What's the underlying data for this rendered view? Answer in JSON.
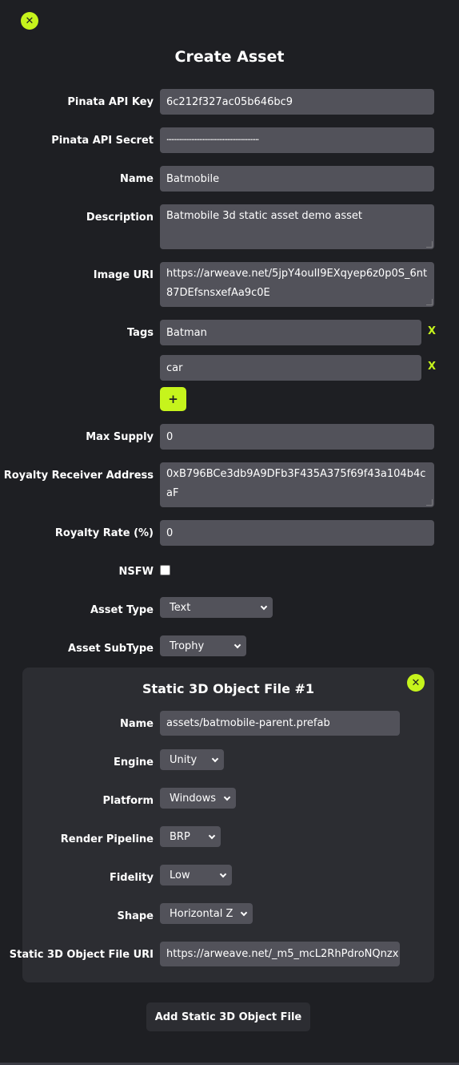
{
  "header": {
    "close_icon": "x-icon",
    "title": "Create Asset"
  },
  "form": {
    "pinata_api_key": {
      "label": "Pinata API Key",
      "value": "6c212f327ac05b646bc9"
    },
    "pinata_api_secret": {
      "label": "Pinata API Secret",
      "value": "••••••••••••••••••••••••••••••••••••••••••••••••••••••••••••••"
    },
    "name": {
      "label": "Name",
      "value": "Batmobile"
    },
    "description": {
      "label": "Description",
      "value": "Batmobile 3d static asset demo asset"
    },
    "image_uri": {
      "label": "Image URI",
      "value": "https://arweave.net/5jpY4ouII9EXqyep6z0p0S_6nt87DEfsnsxefAa9c0E"
    },
    "tags": {
      "label": "Tags",
      "items": [
        {
          "value": "Batman",
          "remove": "X"
        },
        {
          "value": "car",
          "remove": "X"
        }
      ],
      "add_label": "+"
    },
    "max_supply": {
      "label": "Max Supply",
      "value": "0"
    },
    "royalty_receiver": {
      "label": "Royalty Receiver Address",
      "value": "0xB796BCe3db9A9DFb3F435A375f69f43a104b4caF"
    },
    "royalty_rate": {
      "label": "Royalty Rate (%)",
      "value": "0"
    },
    "nsfw": {
      "label": "NSFW",
      "checked": false
    },
    "asset_type": {
      "label": "Asset Type",
      "value": "Text"
    },
    "asset_subtype": {
      "label": "Asset SubType",
      "value": "Trophy"
    }
  },
  "static_file": {
    "title": "Static 3D Object File #1",
    "close_icon": "x-icon",
    "name": {
      "label": "Name",
      "value": "assets/batmobile-parent.prefab"
    },
    "engine": {
      "label": "Engine",
      "value": "Unity"
    },
    "platform": {
      "label": "Platform",
      "value": "Windows"
    },
    "render_pipeline": {
      "label": "Render Pipeline",
      "value": "BRP"
    },
    "fidelity": {
      "label": "Fidelity",
      "value": "Low"
    },
    "shape": {
      "label": "Shape",
      "value": "Horizontal Z"
    },
    "file_uri": {
      "label": "Static 3D Object File URI",
      "value": "https://arweave.net/_m5_mcL2RhPdroNQnzx"
    }
  },
  "footer": {
    "add_button": "Add Static 3D Object File"
  },
  "colors": {
    "background": "#1e1f23",
    "accent": "#c6f41c",
    "field": "#52525a",
    "panel": "#2c2d32"
  }
}
